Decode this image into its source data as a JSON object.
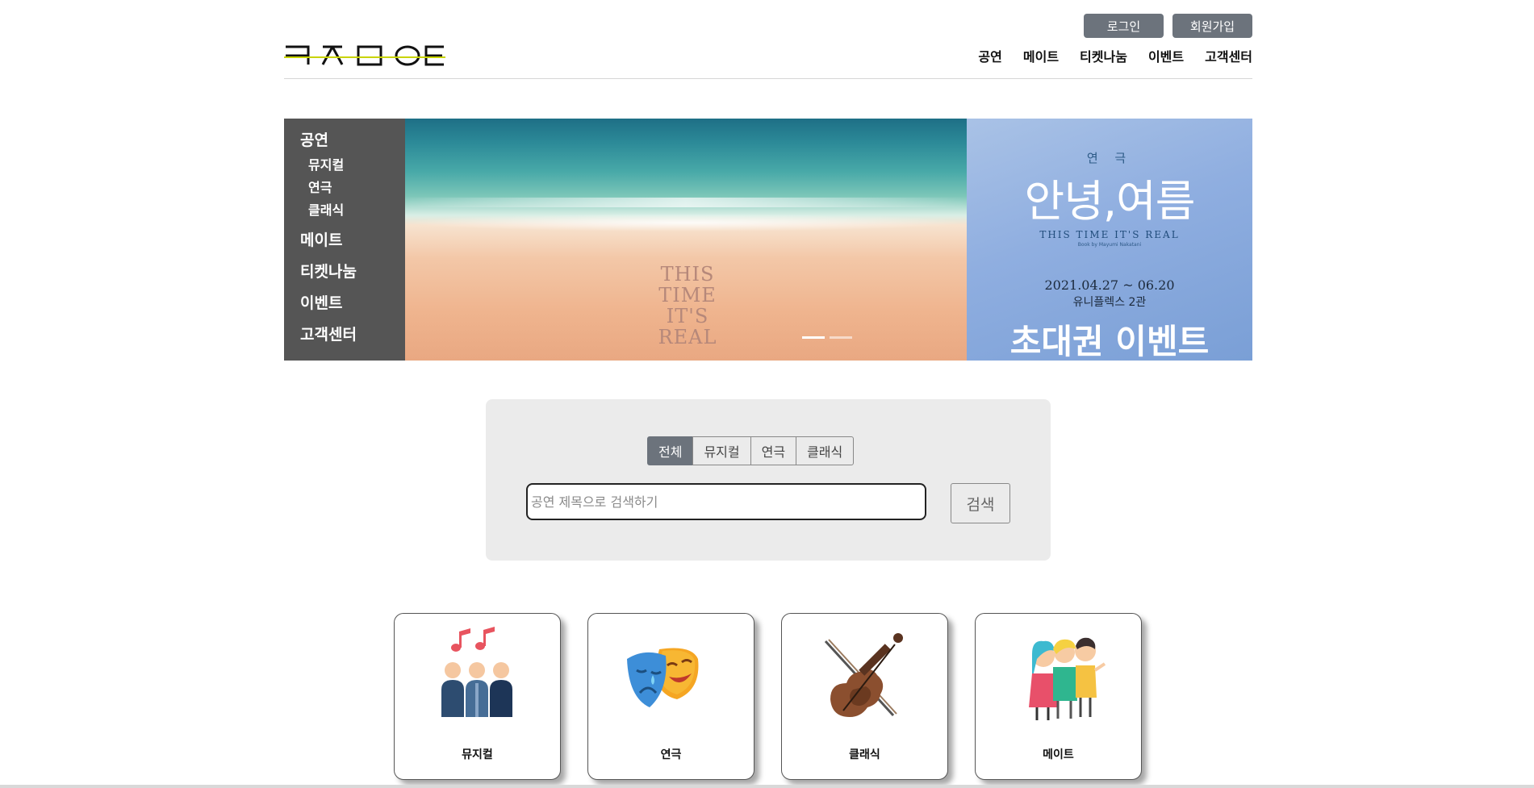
{
  "header": {
    "logo_text": "ㅋㅊㅁㅇㅌ",
    "auth": {
      "login": "로그인",
      "join": "회원가입"
    },
    "nav": [
      "공연",
      "메이트",
      "티켓나눔",
      "이벤트",
      "고객센터"
    ]
  },
  "sidebar": {
    "items": [
      {
        "label": "공연",
        "children": [
          "뮤지컬",
          "연극",
          "클래식"
        ]
      },
      {
        "label": "메이트"
      },
      {
        "label": "티켓나눔"
      },
      {
        "label": "이벤트"
      },
      {
        "label": "고객센터"
      }
    ]
  },
  "banner": {
    "beach_lines": [
      "THIS",
      "TIME",
      "IT'S",
      "REAL"
    ],
    "poster": {
      "genre": "연 극",
      "title": "안녕,여름",
      "english": "THIS TIME IT'S REAL",
      "book": "Book by Mayumi Nakatani",
      "date": "2021.04.27 ~ 06.20",
      "venue": "유니플렉스 2관",
      "event": "초대권 이벤트"
    },
    "slide_count": 2,
    "active_slide": 0
  },
  "search": {
    "tabs": [
      "전체",
      "뮤지컬",
      "연극",
      "클래식"
    ],
    "active_tab": 0,
    "placeholder": "공연 제목으로 검색하기",
    "value": "",
    "button": "검색"
  },
  "categories": [
    {
      "label": "뮤지컬",
      "icon": "singers-icon"
    },
    {
      "label": "연극",
      "icon": "theater-masks-icon"
    },
    {
      "label": "클래식",
      "icon": "violin-icon"
    },
    {
      "label": "메이트",
      "icon": "friends-icon"
    }
  ],
  "colors": {
    "accent": "#6c737c",
    "sidebar": "#555555",
    "search_bg": "#ebebeb"
  }
}
